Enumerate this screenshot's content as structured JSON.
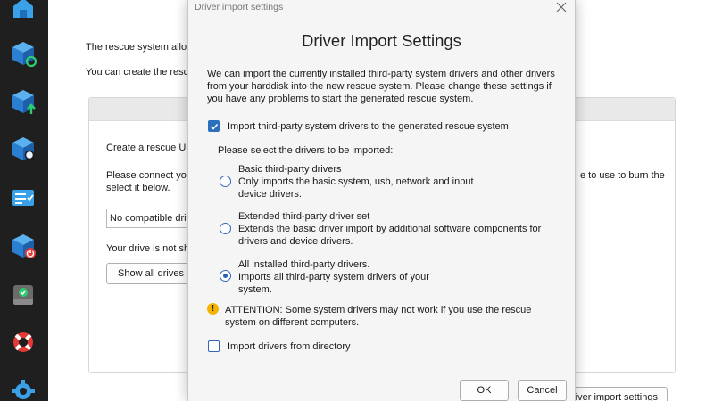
{
  "background": {
    "line1": "The rescue system allow",
    "line2": "You can create the rescu",
    "create_text": "Create a rescue US",
    "connect_text_1": "Please connect you",
    "connect_text_2": "select it below.",
    "right_text": "e to use to burn the",
    "drive_select_value": "No compatible driv",
    "drive_not_shown": "Your drive is not sh",
    "show_all_drives_label": "Show all drives",
    "driver_import_button_label": "river import settings"
  },
  "dialog": {
    "window_title": "Driver import settings",
    "heading": "Driver Import Settings",
    "intro": "We can import the currently installed third-party system drivers and other drivers from your harddisk into the new rescue system. Please change these settings if you have any problems to start the generated rescue system.",
    "import_third_party": {
      "label": "Import third-party system drivers to the generated rescue system",
      "checked": true
    },
    "select_prompt": "Please select the drivers to be imported:",
    "options": [
      {
        "title": "Basic third-party drivers",
        "description": "Only imports the basic system, usb, network and input device drivers.",
        "selected": false
      },
      {
        "title": "Extended third-party driver set",
        "description": "Extends the basic driver import by additional software components for drivers and device drivers.",
        "selected": false
      },
      {
        "title": "All installed third-party drivers.",
        "description": "Imports all third-party system drivers of your system.",
        "selected": true
      }
    ],
    "attention": "ATTENTION: Some system drivers may not work if you use the rescue system on different computers.",
    "import_directory": {
      "label": "Import drivers from directory",
      "checked": false
    },
    "ok_label": "OK",
    "cancel_label": "Cancel"
  },
  "sidebar": {
    "icons": [
      "home-icon",
      "backup-refresh-icon",
      "backup-upload-icon",
      "search-backup-icon",
      "task-list-icon",
      "power-off-icon",
      "drive-check-icon",
      "rescue-lifebuoy-icon",
      "settings-gear-icon"
    ]
  },
  "colors": {
    "sidebar_bg": "#1f1f1f",
    "accent": "#2b6fbd",
    "warning": "#f4b400",
    "dialog_bg": "#f5f5f5"
  }
}
